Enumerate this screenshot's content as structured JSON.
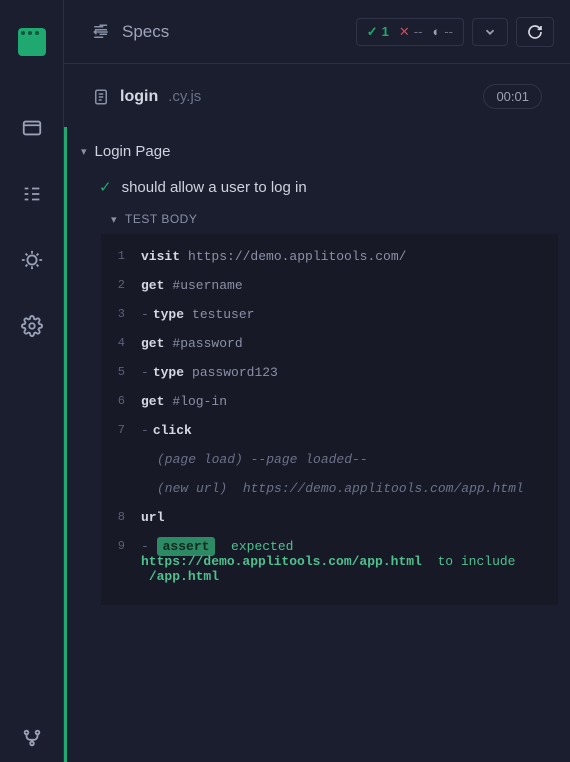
{
  "topbar": {
    "title": "Specs",
    "passed": "1",
    "failed": "--",
    "pending": "--"
  },
  "spec": {
    "name": "login",
    "ext": ".cy.js",
    "time": "00:01"
  },
  "describe": {
    "title": "Login Page"
  },
  "test": {
    "title": "should allow a user to log in",
    "body_label": "TEST BODY"
  },
  "commands": [
    {
      "num": "1",
      "name": "visit",
      "arg": "https://demo.applitools.com/",
      "child": false
    },
    {
      "num": "2",
      "name": "get",
      "arg": "#username",
      "child": false
    },
    {
      "num": "3",
      "name": "type",
      "arg": "testuser",
      "child": true
    },
    {
      "num": "4",
      "name": "get",
      "arg": "#password",
      "child": false
    },
    {
      "num": "5",
      "name": "type",
      "arg": "password123",
      "child": true
    },
    {
      "num": "6",
      "name": "get",
      "arg": "#log-in",
      "child": false
    },
    {
      "num": "7",
      "name": "click",
      "arg": "",
      "child": true
    }
  ],
  "events": {
    "page_load": "(page load)  --page loaded--",
    "new_url_label": "(new url)",
    "new_url": "https://demo.applitools.com/app.html"
  },
  "urlcmd": {
    "num": "8",
    "name": "url"
  },
  "assert": {
    "num": "9",
    "pill": "assert",
    "expected": "expected",
    "value": "https://demo.applitools.com/app.html",
    "to": "to include",
    "substr": "/app.html"
  }
}
